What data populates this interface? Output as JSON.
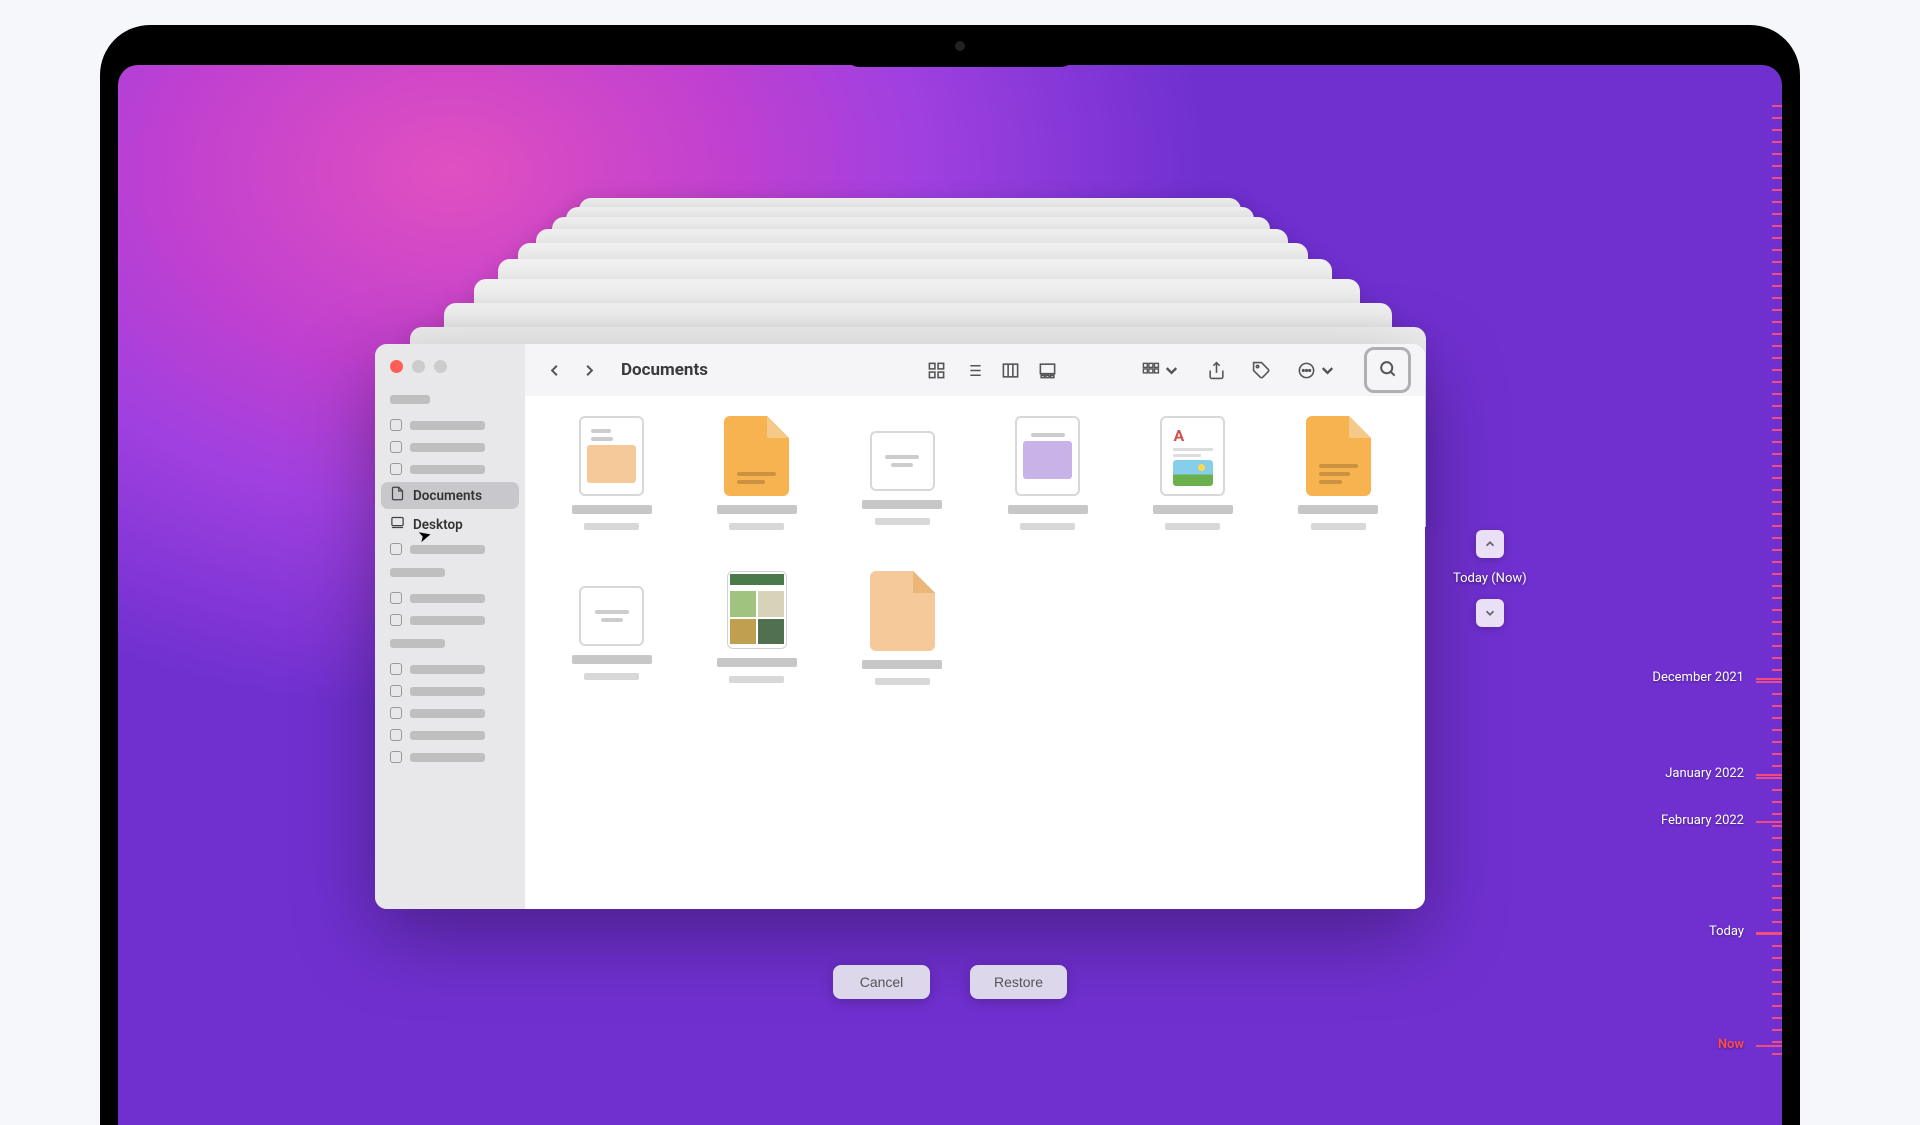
{
  "window": {
    "title": "Documents",
    "traffic_lights": [
      "close",
      "minimize",
      "zoom"
    ]
  },
  "sidebar": {
    "items": [
      {
        "label": "Documents",
        "selected": true
      },
      {
        "label": "Desktop",
        "selected": false
      }
    ]
  },
  "timeline": {
    "current_label": "Today (Now)",
    "marks": [
      {
        "label": "December 2021"
      },
      {
        "label": "January 2022"
      },
      {
        "label": "February 2022"
      },
      {
        "label": "Today"
      },
      {
        "label": "Now"
      }
    ]
  },
  "actions": {
    "cancel": "Cancel",
    "restore": "Restore"
  },
  "colors": {
    "traffic_red": "#ff5f57",
    "accent_orange": "#f8b351"
  }
}
